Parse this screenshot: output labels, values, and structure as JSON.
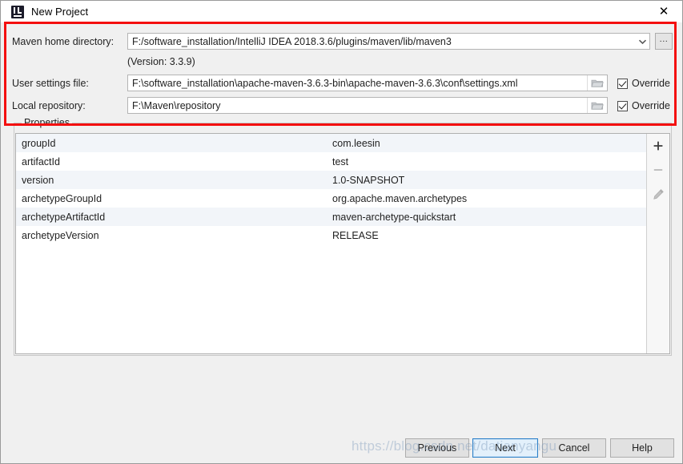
{
  "window": {
    "title": "New Project",
    "app_icon": "intellij-idea-icon",
    "close_label": "✕"
  },
  "form": {
    "maven_home": {
      "label": "Maven home directory:",
      "value": "F:/software_installation/IntelliJ IDEA 2018.3.6/plugins/maven/lib/maven3",
      "dropdown_icon": "chevron-down-icon",
      "browse_label": "...",
      "version_note": "(Version: 3.3.9)"
    },
    "user_settings": {
      "label": "User settings file:",
      "value": "F:\\software_installation\\apache-maven-3.6.3-bin\\apache-maven-3.6.3\\conf\\settings.xml",
      "folder_icon": "folder-icon",
      "override_label": "Override",
      "override_checked": true
    },
    "local_repository": {
      "label": "Local repository:",
      "value": "F:\\Maven\\repository",
      "folder_icon": "folder-icon",
      "override_label": "Override",
      "override_checked": true
    }
  },
  "properties": {
    "legend": "Properties",
    "rows": [
      {
        "key": "groupId",
        "value": "com.leesin"
      },
      {
        "key": "artifactId",
        "value": "test"
      },
      {
        "key": "version",
        "value": "1.0-SNAPSHOT"
      },
      {
        "key": "archetypeGroupId",
        "value": "org.apache.maven.archetypes"
      },
      {
        "key": "archetypeArtifactId",
        "value": "maven-archetype-quickstart"
      },
      {
        "key": "archetypeVersion",
        "value": "RELEASE"
      }
    ],
    "toolbar": [
      {
        "name": "add-property-button",
        "icon": "plus-icon",
        "enabled": true
      },
      {
        "name": "remove-property-button",
        "icon": "minus-icon",
        "enabled": false
      },
      {
        "name": "edit-property-button",
        "icon": "pencil-icon",
        "enabled": false
      }
    ]
  },
  "footer": {
    "previous_label": "Previous",
    "next_label": "Next",
    "cancel_label": "Cancel",
    "help_label": "Help"
  },
  "watermark": {
    "text": "https://blog.csdn.net/datianyangu"
  },
  "colors": {
    "annotation_red": "#f40f0f",
    "primary_button_border": "#2a7ec8",
    "row_stripe": "#f2f5f9",
    "dialog_bg": "#f0f0f0"
  }
}
